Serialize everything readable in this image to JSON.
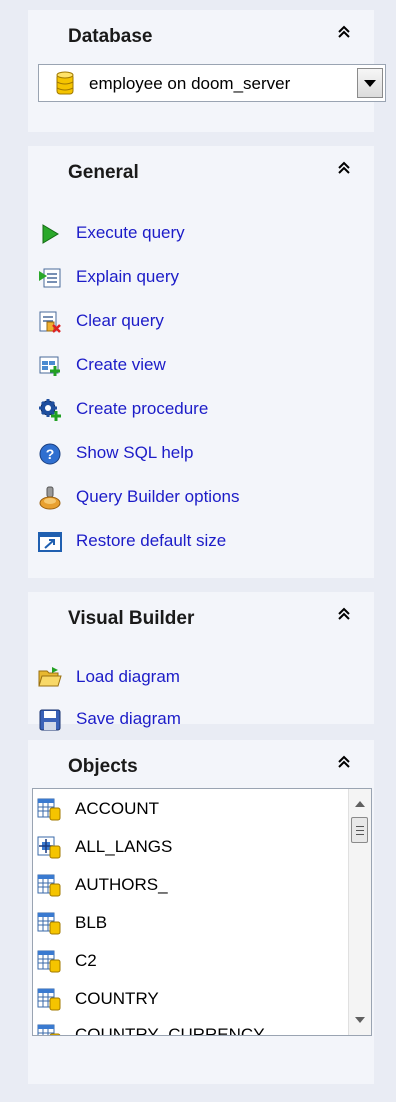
{
  "database": {
    "title": "Database",
    "selected": "employee on doom_server"
  },
  "general": {
    "title": "General",
    "items": [
      {
        "label": "Execute query",
        "icon": "play-icon"
      },
      {
        "label": "Explain query",
        "icon": "explain-icon"
      },
      {
        "label": "Clear query",
        "icon": "clear-icon"
      },
      {
        "label": "Create view",
        "icon": "create-view-icon"
      },
      {
        "label": "Create procedure",
        "icon": "gear-icon"
      },
      {
        "label": "Show SQL help",
        "icon": "help-icon"
      },
      {
        "label": "Query Builder options",
        "icon": "options-icon"
      },
      {
        "label": "Restore default size",
        "icon": "restore-icon"
      }
    ]
  },
  "visual_builder": {
    "title": "Visual Builder",
    "items": [
      {
        "label": "Load diagram",
        "icon": "folder-open-icon"
      },
      {
        "label": "Save diagram",
        "icon": "floppy-icon"
      }
    ]
  },
  "objects": {
    "title": "Objects",
    "items": [
      {
        "label": "ACCOUNT",
        "icon": "table-icon"
      },
      {
        "label": "ALL_LANGS",
        "icon": "view-icon"
      },
      {
        "label": "AUTHORS_",
        "icon": "table-icon"
      },
      {
        "label": "BLB",
        "icon": "table-icon"
      },
      {
        "label": "C2",
        "icon": "table-icon"
      },
      {
        "label": "COUNTRY",
        "icon": "table-icon"
      },
      {
        "label": "COUNTRY_CURRENCY",
        "icon": "table-icon"
      }
    ]
  },
  "colors": {
    "link": "#1c1cc8",
    "panel": "#e9ecf4",
    "section": "#f3f5fa"
  }
}
